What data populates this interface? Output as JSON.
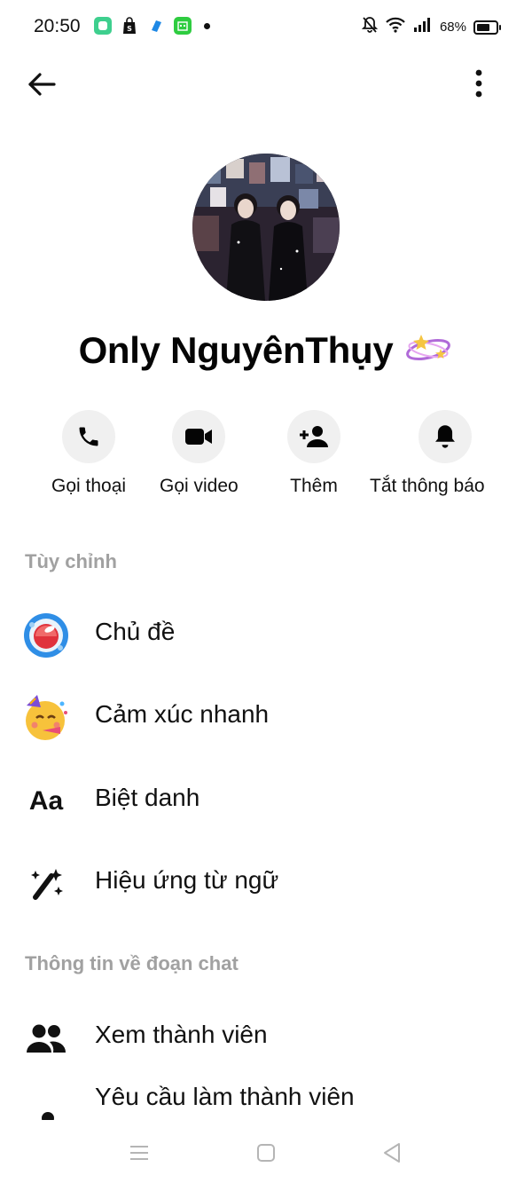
{
  "status_bar": {
    "time": "20:50",
    "battery": "68%",
    "battery_level": 0.68,
    "icons": [
      "app-icon",
      "shopping-bag-icon",
      "messenger-icon",
      "calendar-app-icon",
      "notification-dot",
      "bell-off-icon",
      "wifi-icon",
      "signal-icon",
      "battery-icon"
    ]
  },
  "header": {
    "back_icon": "arrow-left-icon",
    "more_icon": "more-vertical-icon"
  },
  "profile": {
    "name": "Only NguyênThụy",
    "decoration_icon": "sparkle-orbit-icon"
  },
  "actions": [
    {
      "label": "Gọi thoại",
      "icon": "phone-icon"
    },
    {
      "label": "Gọi video",
      "icon": "video-camera-icon"
    },
    {
      "label": "Thêm",
      "icon": "add-person-icon"
    },
    {
      "label": "Tắt thông báo",
      "icon": "bell-icon"
    }
  ],
  "customize": {
    "header": "Tùy chỉnh",
    "items": [
      {
        "label": "Chủ đề",
        "icon": "theme-icon"
      },
      {
        "label": "Cảm xúc nhanh",
        "icon": "party-emoji-icon"
      },
      {
        "label": "Biệt danh",
        "icon_text": "Aa"
      },
      {
        "label": "Hiệu ứng từ ngữ",
        "icon": "magic-wand-icon"
      }
    ]
  },
  "chat_info": {
    "header": "Thông tin về đoạn chat",
    "items": [
      {
        "label": "Xem thành viên",
        "icon": "people-icon"
      },
      {
        "label": "Yêu cầu làm thành viên",
        "icon": "person-icon"
      }
    ]
  },
  "nav": {
    "icons": [
      "menu-icon",
      "home-square-icon",
      "back-triangle-icon"
    ]
  },
  "colors": {
    "accent": "#0084ff",
    "muted": "#a1a1a1",
    "circle_bg": "#f0f0f0"
  }
}
